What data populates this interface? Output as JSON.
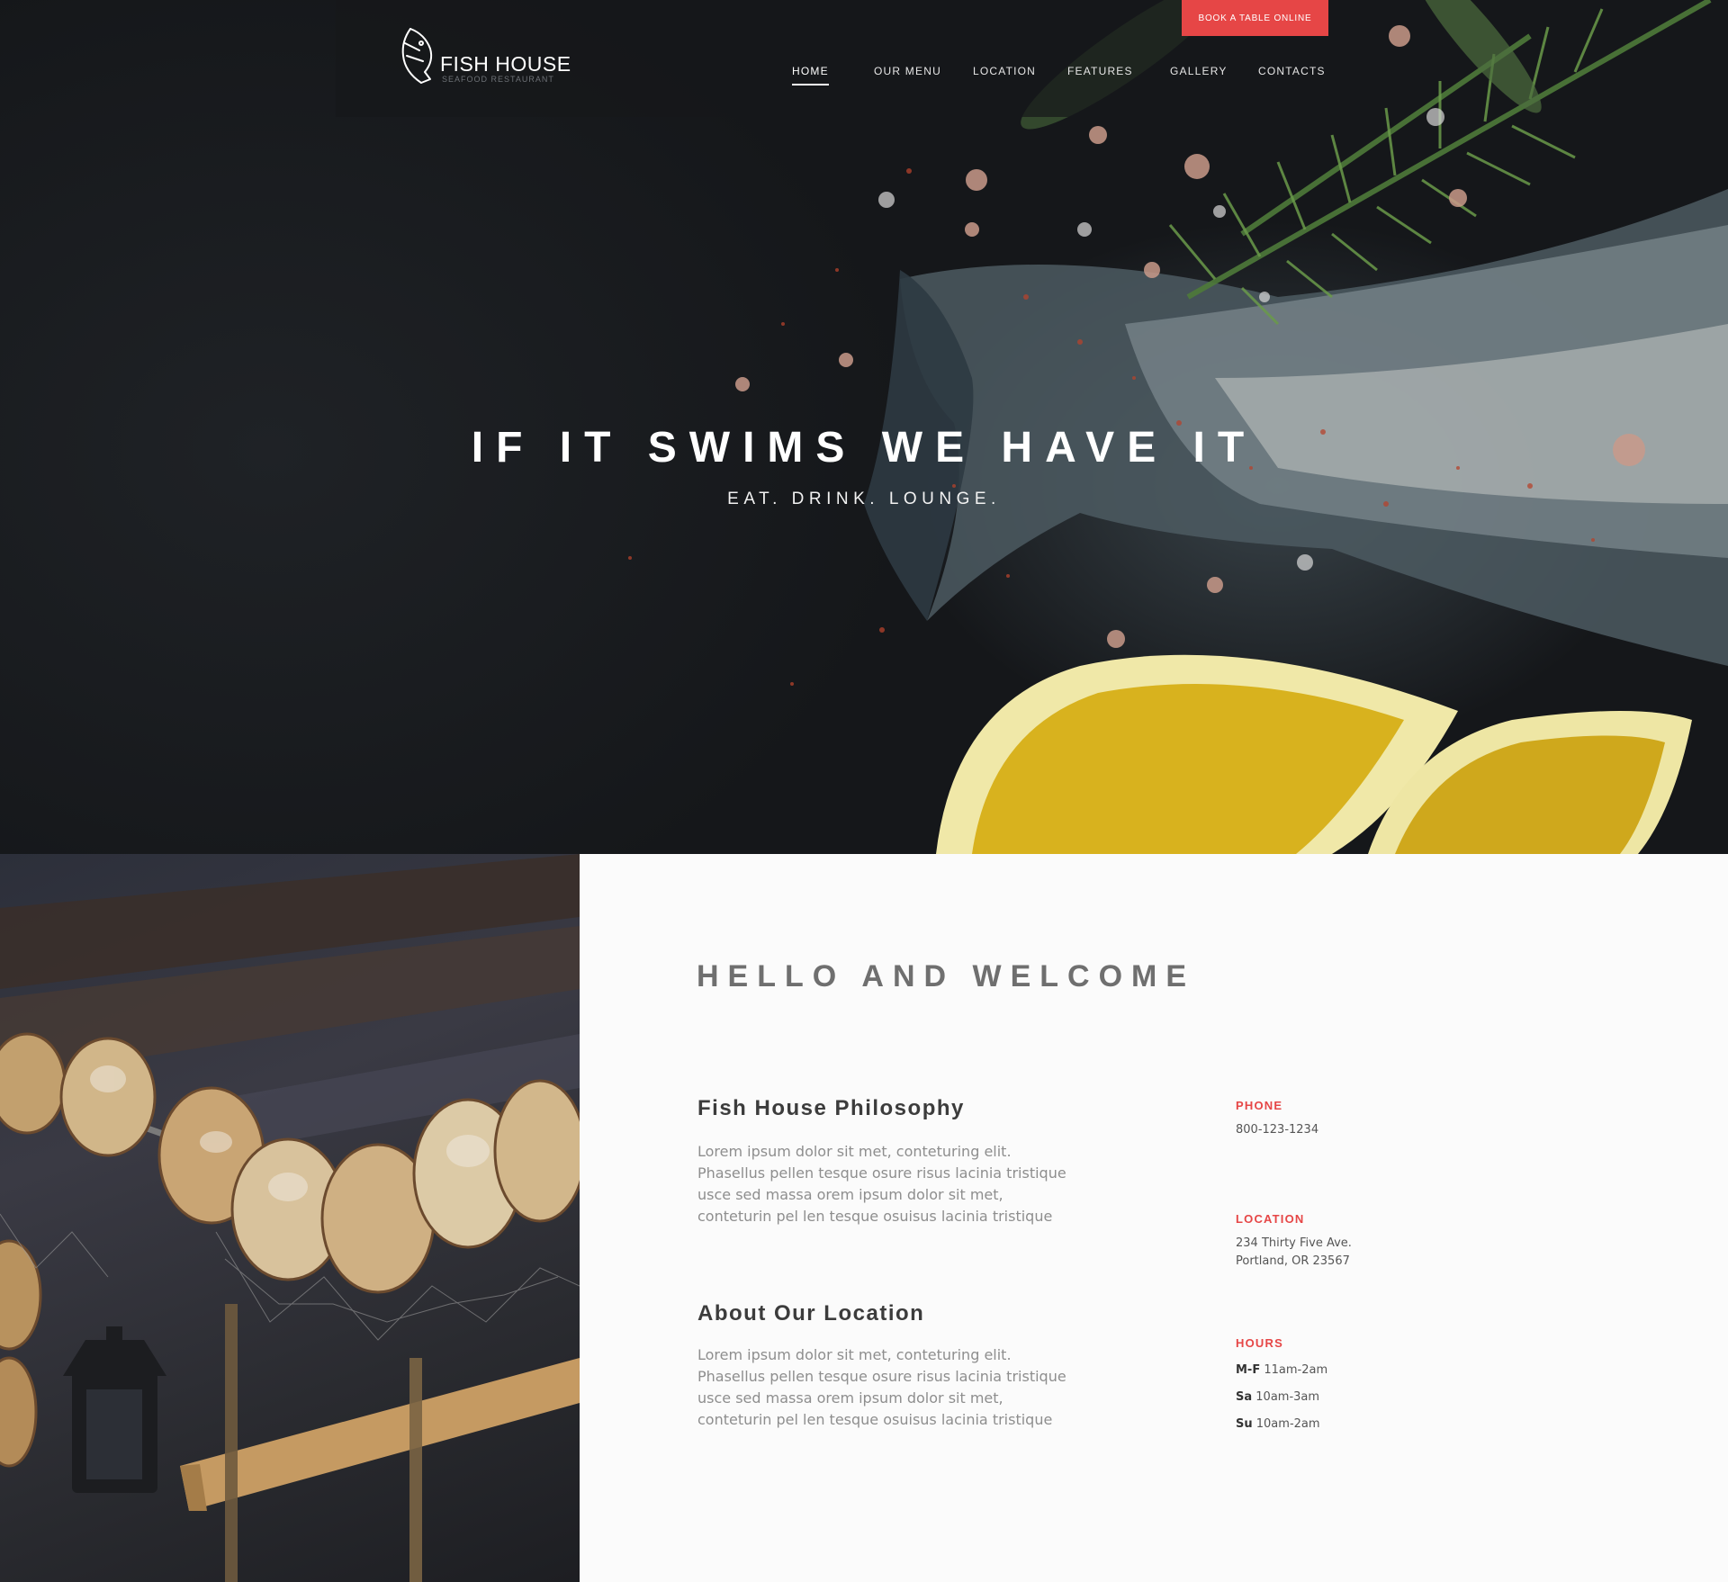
{
  "brand": {
    "name": "FISH HOUSE",
    "tagline": "SEAFOOD RESTAURANT"
  },
  "header": {
    "book_button": "BOOK A TABLE  ONLINE",
    "nav": [
      {
        "label": "HOME",
        "active": true
      },
      {
        "label": "OUR MENU",
        "active": false
      },
      {
        "label": "LOCATION",
        "active": false
      },
      {
        "label": "FEATURES",
        "active": false
      },
      {
        "label": "GALLERY",
        "active": false
      },
      {
        "label": "CONTACTS",
        "active": false
      }
    ]
  },
  "hero": {
    "title": "IF IT SWIMS WE HAVE IT",
    "subtitle": "EAT. DRINK. LOUNGE."
  },
  "about": {
    "heading": "HELLO AND WELCOME",
    "blocks": [
      {
        "title": "Fish House Philosophy",
        "text": "Lorem ipsum dolor sit met, conteturing elit. Phasellus pellen tesque osure risus lacinia tristique usce sed massa orem ipsum dolor sit met, conteturin pel len tesque osuisus lacinia tristique"
      },
      {
        "title": "About Our Location",
        "text": "Lorem ipsum dolor sit met, conteturing elit. Phasellus pellen tesque osure risus lacinia tristique usce sed massa orem ipsum dolor sit met, conteturin pel len tesque osuisus lacinia tristique"
      }
    ]
  },
  "contact": {
    "phone_label": "PHONE",
    "phone": "800-123-1234",
    "location_label": "LOCATION",
    "address_line1": "234 Thirty Five Ave.",
    "address_line2": "Portland, OR 23567",
    "hours_label": "HOURS",
    "hours": [
      {
        "day": "M-F",
        "time": "11am-2am"
      },
      {
        "day": "Sa",
        "time": "10am-3am"
      },
      {
        "day": "Su",
        "time": "10am-2am"
      }
    ]
  },
  "colors": {
    "accent": "#e64646",
    "hero_bg": "#16181b",
    "content_bg": "#fbfbfb"
  },
  "icons": [
    "fish-logo-icon"
  ]
}
